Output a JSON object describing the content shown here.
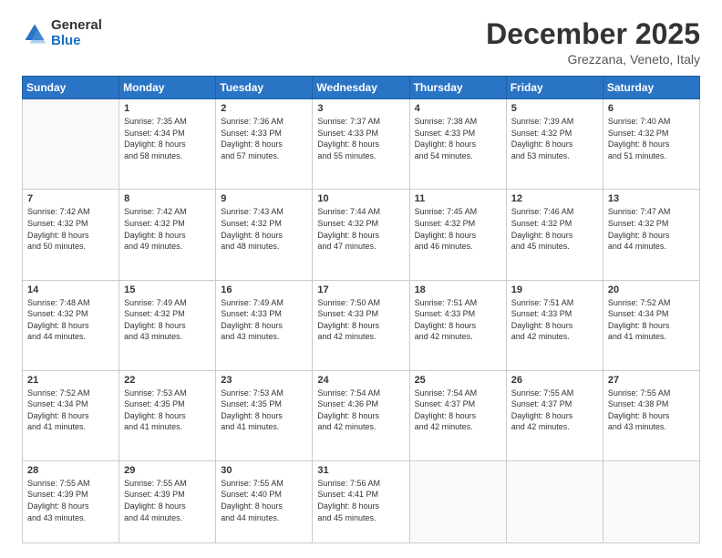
{
  "logo": {
    "line1": "General",
    "line2": "Blue"
  },
  "header": {
    "month_year": "December 2025",
    "location": "Grezzana, Veneto, Italy"
  },
  "weekdays": [
    "Sunday",
    "Monday",
    "Tuesday",
    "Wednesday",
    "Thursday",
    "Friday",
    "Saturday"
  ],
  "weeks": [
    [
      {
        "day": "",
        "info": ""
      },
      {
        "day": "1",
        "info": "Sunrise: 7:35 AM\nSunset: 4:34 PM\nDaylight: 8 hours\nand 58 minutes."
      },
      {
        "day": "2",
        "info": "Sunrise: 7:36 AM\nSunset: 4:33 PM\nDaylight: 8 hours\nand 57 minutes."
      },
      {
        "day": "3",
        "info": "Sunrise: 7:37 AM\nSunset: 4:33 PM\nDaylight: 8 hours\nand 55 minutes."
      },
      {
        "day": "4",
        "info": "Sunrise: 7:38 AM\nSunset: 4:33 PM\nDaylight: 8 hours\nand 54 minutes."
      },
      {
        "day": "5",
        "info": "Sunrise: 7:39 AM\nSunset: 4:32 PM\nDaylight: 8 hours\nand 53 minutes."
      },
      {
        "day": "6",
        "info": "Sunrise: 7:40 AM\nSunset: 4:32 PM\nDaylight: 8 hours\nand 51 minutes."
      }
    ],
    [
      {
        "day": "7",
        "info": "Sunrise: 7:42 AM\nSunset: 4:32 PM\nDaylight: 8 hours\nand 50 minutes."
      },
      {
        "day": "8",
        "info": "Sunrise: 7:42 AM\nSunset: 4:32 PM\nDaylight: 8 hours\nand 49 minutes."
      },
      {
        "day": "9",
        "info": "Sunrise: 7:43 AM\nSunset: 4:32 PM\nDaylight: 8 hours\nand 48 minutes."
      },
      {
        "day": "10",
        "info": "Sunrise: 7:44 AM\nSunset: 4:32 PM\nDaylight: 8 hours\nand 47 minutes."
      },
      {
        "day": "11",
        "info": "Sunrise: 7:45 AM\nSunset: 4:32 PM\nDaylight: 8 hours\nand 46 minutes."
      },
      {
        "day": "12",
        "info": "Sunrise: 7:46 AM\nSunset: 4:32 PM\nDaylight: 8 hours\nand 45 minutes."
      },
      {
        "day": "13",
        "info": "Sunrise: 7:47 AM\nSunset: 4:32 PM\nDaylight: 8 hours\nand 44 minutes."
      }
    ],
    [
      {
        "day": "14",
        "info": "Sunrise: 7:48 AM\nSunset: 4:32 PM\nDaylight: 8 hours\nand 44 minutes."
      },
      {
        "day": "15",
        "info": "Sunrise: 7:49 AM\nSunset: 4:32 PM\nDaylight: 8 hours\nand 43 minutes."
      },
      {
        "day": "16",
        "info": "Sunrise: 7:49 AM\nSunset: 4:33 PM\nDaylight: 8 hours\nand 43 minutes."
      },
      {
        "day": "17",
        "info": "Sunrise: 7:50 AM\nSunset: 4:33 PM\nDaylight: 8 hours\nand 42 minutes."
      },
      {
        "day": "18",
        "info": "Sunrise: 7:51 AM\nSunset: 4:33 PM\nDaylight: 8 hours\nand 42 minutes."
      },
      {
        "day": "19",
        "info": "Sunrise: 7:51 AM\nSunset: 4:33 PM\nDaylight: 8 hours\nand 42 minutes."
      },
      {
        "day": "20",
        "info": "Sunrise: 7:52 AM\nSunset: 4:34 PM\nDaylight: 8 hours\nand 41 minutes."
      }
    ],
    [
      {
        "day": "21",
        "info": "Sunrise: 7:52 AM\nSunset: 4:34 PM\nDaylight: 8 hours\nand 41 minutes."
      },
      {
        "day": "22",
        "info": "Sunrise: 7:53 AM\nSunset: 4:35 PM\nDaylight: 8 hours\nand 41 minutes."
      },
      {
        "day": "23",
        "info": "Sunrise: 7:53 AM\nSunset: 4:35 PM\nDaylight: 8 hours\nand 41 minutes."
      },
      {
        "day": "24",
        "info": "Sunrise: 7:54 AM\nSunset: 4:36 PM\nDaylight: 8 hours\nand 42 minutes."
      },
      {
        "day": "25",
        "info": "Sunrise: 7:54 AM\nSunset: 4:37 PM\nDaylight: 8 hours\nand 42 minutes."
      },
      {
        "day": "26",
        "info": "Sunrise: 7:55 AM\nSunset: 4:37 PM\nDaylight: 8 hours\nand 42 minutes."
      },
      {
        "day": "27",
        "info": "Sunrise: 7:55 AM\nSunset: 4:38 PM\nDaylight: 8 hours\nand 43 minutes."
      }
    ],
    [
      {
        "day": "28",
        "info": "Sunrise: 7:55 AM\nSunset: 4:39 PM\nDaylight: 8 hours\nand 43 minutes."
      },
      {
        "day": "29",
        "info": "Sunrise: 7:55 AM\nSunset: 4:39 PM\nDaylight: 8 hours\nand 44 minutes."
      },
      {
        "day": "30",
        "info": "Sunrise: 7:55 AM\nSunset: 4:40 PM\nDaylight: 8 hours\nand 44 minutes."
      },
      {
        "day": "31",
        "info": "Sunrise: 7:56 AM\nSunset: 4:41 PM\nDaylight: 8 hours\nand 45 minutes."
      },
      {
        "day": "",
        "info": ""
      },
      {
        "day": "",
        "info": ""
      },
      {
        "day": "",
        "info": ""
      }
    ]
  ]
}
